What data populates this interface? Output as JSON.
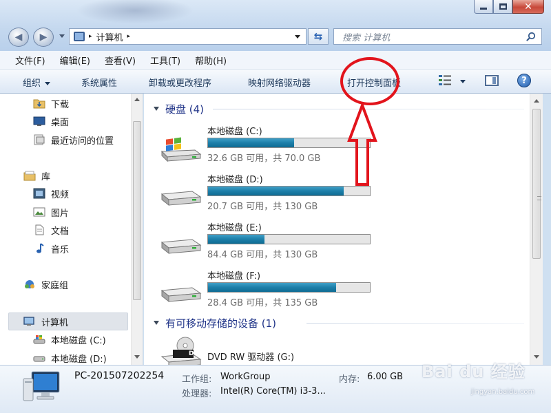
{
  "window": {
    "address": {
      "path_segment": "计算机",
      "separator": "▸"
    },
    "search": {
      "placeholder": "搜索 计算机"
    }
  },
  "menubar": {
    "items": [
      "文件(F)",
      "编辑(E)",
      "查看(V)",
      "工具(T)",
      "帮助(H)"
    ]
  },
  "commandbar": {
    "items": [
      "组织",
      "系统属性",
      "卸载或更改程序",
      "映射网络驱动器",
      "打开控制面板"
    ]
  },
  "navpane": {
    "favorites": [
      "下载",
      "桌面",
      "最近访问的位置"
    ],
    "libraries_header": "库",
    "libraries": [
      "视频",
      "图片",
      "文档",
      "音乐"
    ],
    "homegroup": "家庭组",
    "computer": "计算机",
    "drives": [
      "本地磁盘 (C:)",
      "本地磁盘 (D:)"
    ]
  },
  "content": {
    "hard_disks_header": "硬盘 (4)",
    "drives": [
      {
        "name": "本地磁盘 (C:)",
        "info": "32.6 GB 可用，共 70.0 GB",
        "used_fraction": 0.534,
        "icon": "windows-drive-icon"
      },
      {
        "name": "本地磁盘 (D:)",
        "info": "20.7 GB 可用，共 130 GB",
        "used_fraction": 0.84,
        "icon": "hard-drive-icon"
      },
      {
        "name": "本地磁盘 (E:)",
        "info": "84.4 GB 可用，共 130 GB",
        "used_fraction": 0.351,
        "icon": "hard-drive-icon"
      },
      {
        "name": "本地磁盘 (F:)",
        "info": "28.4 GB 可用，共 135 GB",
        "used_fraction": 0.79,
        "icon": "hard-drive-icon"
      }
    ],
    "removable_header": "有可移动存储的设备 (1)",
    "removable": [
      {
        "name": "DVD RW 驱动器 (G:)",
        "icon_label": "DVD"
      }
    ]
  },
  "details": {
    "pc_name": "PC-201507202254",
    "workgroup_label": "工作组:",
    "workgroup_value": "WorkGroup",
    "memory_label": "内存:",
    "memory_value": "6.00 GB",
    "processor_label": "处理器:",
    "processor_value": "Intel(R) Core(TM) i3-3..."
  },
  "watermark": {
    "logo": "Bai du 经验",
    "url": "jingyan.baidu.com"
  },
  "colors": {
    "bar_fill": "#1d7fa9",
    "group_header": "#1e3287",
    "annotation": "#e2141c",
    "window_frame": "#cfe0f1"
  }
}
